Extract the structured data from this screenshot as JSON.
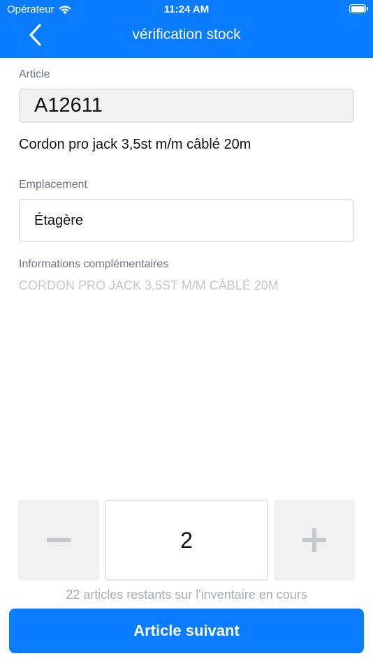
{
  "status_bar": {
    "carrier": "Opérateur",
    "time": "11:24 AM"
  },
  "nav": {
    "title": "vérification stock",
    "back_icon": "chevron-left-icon"
  },
  "article": {
    "label": "Article",
    "value": "A12611",
    "description": "Cordon pro jack 3,5st m/m câblé 20m"
  },
  "location": {
    "label": "Emplacement",
    "value": "Étagère"
  },
  "additional_info": {
    "label": "Informations complémentaires",
    "value": "CORDON PRO JACK 3,5ST M/M CÂBLÉ 20M"
  },
  "quantity": {
    "value": "2",
    "minus_icon": "minus-icon",
    "plus_icon": "plus-icon"
  },
  "remaining_text": "22 articles restants sur l'inventaire en cours",
  "next_button_label": "Article suivant",
  "colors": {
    "primary": "#0a7cff",
    "label_gray": "#6b7684",
    "disabled_gray": "#c4c8ce"
  }
}
